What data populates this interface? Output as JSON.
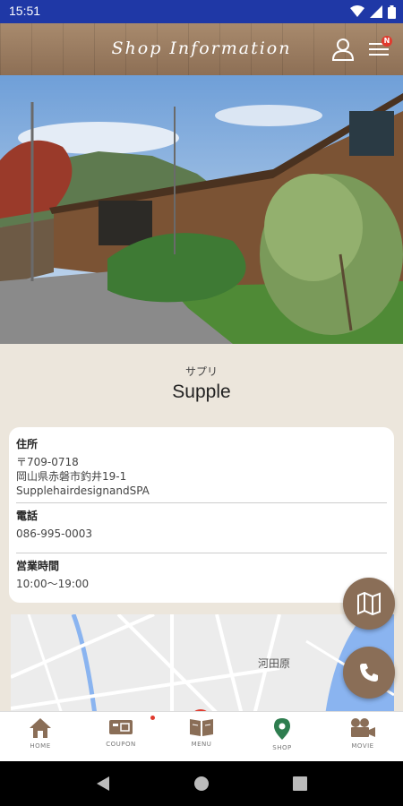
{
  "status_bar": {
    "time": "15:51"
  },
  "header": {
    "title": "Shop Information",
    "badge": "N"
  },
  "shop": {
    "kana": "サプリ",
    "name": "Supple"
  },
  "info": {
    "address_label": "住所",
    "postal": "〒709-0718",
    "address_line": "岡山県赤磐市釣井19-1",
    "shop_fullname": "SupplehairdesignandSPA",
    "phone_label": "電話",
    "phone": "086-995-0003",
    "hours_label": "営業時間",
    "hours": "10:00〜19:00"
  },
  "map": {
    "place_label": "河田原"
  },
  "tabs": [
    {
      "label": "HOME",
      "icon": "home-icon",
      "active": false
    },
    {
      "label": "COUPON",
      "icon": "coupon-icon",
      "active": false,
      "dot": true
    },
    {
      "label": "MENU",
      "icon": "menu-book-icon",
      "active": false
    },
    {
      "label": "SHOP",
      "icon": "map-pin-icon",
      "active": true
    },
    {
      "label": "MOVIE",
      "icon": "movie-camera-icon",
      "active": false
    }
  ],
  "colors": {
    "status_bar": "#1f38a6",
    "header_wood": "#9c7f63",
    "accent_brown": "#8a6e57",
    "active_green": "#2e7d4f",
    "badge_red": "#e03a2e",
    "content_bg": "#ece6dc"
  }
}
